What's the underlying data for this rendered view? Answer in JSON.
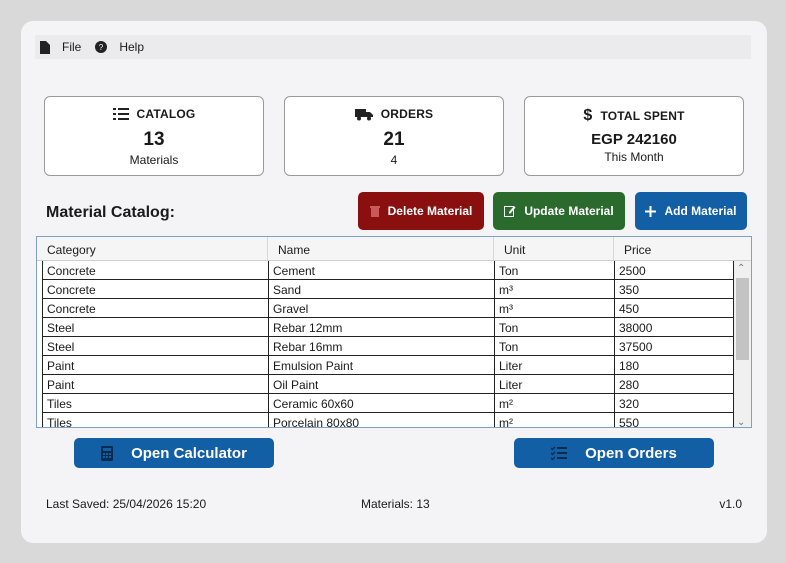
{
  "menu": {
    "file": "File",
    "help": "Help"
  },
  "cards": {
    "catalog": {
      "title": "CATALOG",
      "value": "13",
      "sub": "Materials"
    },
    "orders": {
      "title": "ORDERS",
      "value": "21",
      "sub": "4"
    },
    "spent": {
      "title": "TOTAL SPENT",
      "value": "EGP 242160",
      "sub": "This Month"
    }
  },
  "section_title": "Material Catalog:",
  "buttons": {
    "delete": "Delete Material",
    "update": "Update Material",
    "add": "Add Material",
    "calculator": "Open Calculator",
    "orders": "Open Orders"
  },
  "table": {
    "headers": [
      "Category",
      "Name",
      "Unit",
      "Price"
    ],
    "rows": [
      [
        "Concrete",
        "Cement",
        "Ton",
        "2500"
      ],
      [
        "Concrete",
        "Sand",
        "m³",
        "350"
      ],
      [
        "Concrete",
        "Gravel",
        "m³",
        "450"
      ],
      [
        "Steel",
        "Rebar 12mm",
        "Ton",
        "38000"
      ],
      [
        "Steel",
        "Rebar 16mm",
        "Ton",
        "37500"
      ],
      [
        "Paint",
        "Emulsion Paint",
        "Liter",
        "180"
      ],
      [
        "Paint",
        "Oil Paint",
        "Liter",
        "280"
      ],
      [
        "Tiles",
        "Ceramic 60x60",
        "m²",
        "320"
      ],
      [
        "Tiles",
        "Porcelain 80x80",
        "m²",
        "550"
      ]
    ]
  },
  "footer": {
    "last_saved": "Last Saved: 25/04/2026 15:20",
    "materials": "Materials: 13",
    "version": "v1.0"
  },
  "colors": {
    "delete": "#8a1010",
    "update": "#2a6b2d",
    "primary": "#135fa6"
  }
}
